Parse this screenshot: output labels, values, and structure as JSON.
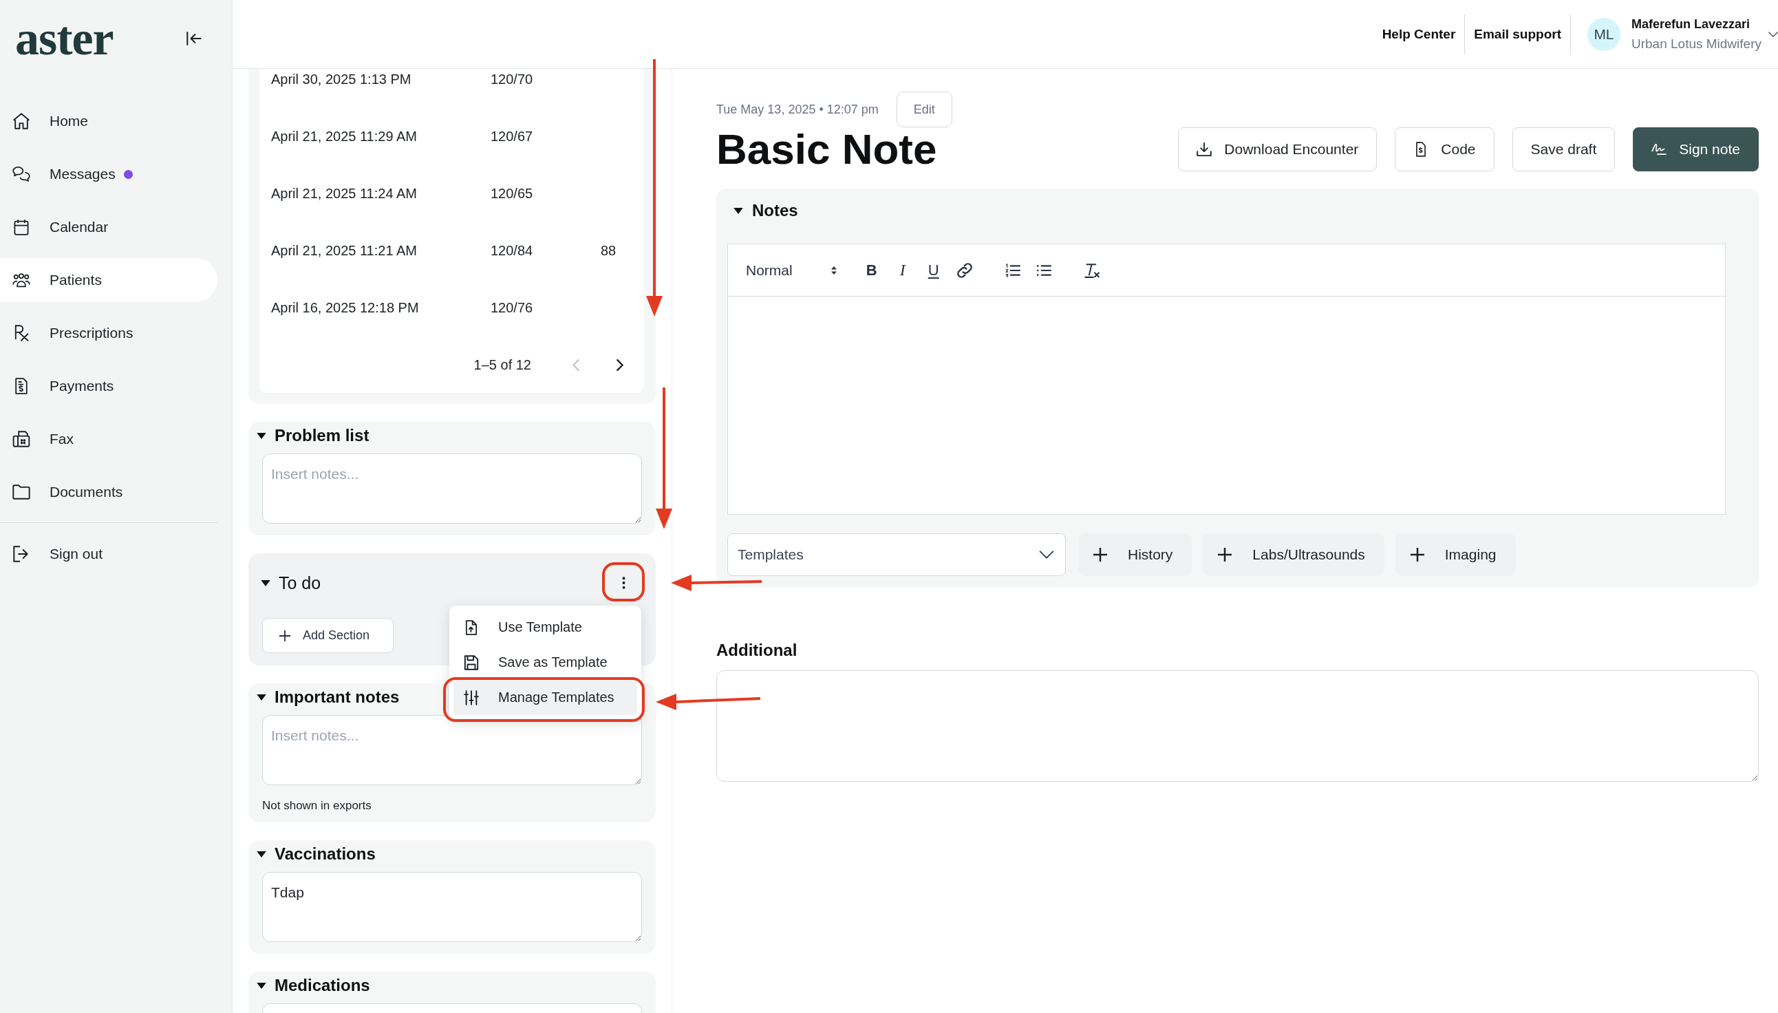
{
  "sidebar": {
    "logo": "aster",
    "items": [
      {
        "kind": "home",
        "label": "Home",
        "selected": false,
        "unread": false
      },
      {
        "kind": "messages",
        "label": "Messages",
        "selected": false,
        "unread": true
      },
      {
        "kind": "calendar",
        "label": "Calendar",
        "selected": false,
        "unread": false
      },
      {
        "kind": "patients",
        "label": "Patients",
        "selected": true,
        "unread": false
      },
      {
        "kind": "prescriptions",
        "label": "Prescriptions",
        "selected": false,
        "unread": false
      },
      {
        "kind": "payments",
        "label": "Payments",
        "selected": false,
        "unread": false
      },
      {
        "kind": "fax",
        "label": "Fax",
        "selected": false,
        "unread": false
      },
      {
        "kind": "documents",
        "label": "Documents",
        "selected": false,
        "unread": false
      }
    ],
    "sign_out": "Sign out"
  },
  "header": {
    "links": [
      "Help Center",
      "Email support"
    ],
    "user": {
      "initials": "ML",
      "name": "Maferefun Lavezzari",
      "organization": "Urban Lotus Midwifery"
    }
  },
  "vitals": {
    "rows": [
      {
        "cells": [
          "April 30, 2025 1:13 PM",
          "120/70"
        ]
      },
      {
        "cells": [
          "April 21, 2025 11:29 AM",
          "120/67"
        ]
      },
      {
        "cells": [
          "April 21, 2025 11:24 AM",
          "120/65"
        ]
      },
      {
        "cells": [
          "April 21, 2025 11:21 AM",
          "120/84",
          "88"
        ]
      },
      {
        "cells": [
          "April 16, 2025 12:18 PM",
          "120/76"
        ]
      }
    ],
    "pagination": {
      "range": "1–5 of 12",
      "previous_disabled": true,
      "next_disabled": false
    }
  },
  "sections": [
    {
      "kind": "text",
      "title": "Problem list",
      "expanded": true,
      "placeholder": "Insert notes..."
    },
    {
      "kind": "todo",
      "title": "To do",
      "expanded": true,
      "menu_button": {
        "annotated": true
      },
      "add_label": "Add Section",
      "menu": {
        "open": true,
        "items": [
          {
            "kind": "use",
            "label": "Use Template",
            "selected": false,
            "annotated": false
          },
          {
            "kind": "save",
            "label": "Save as Template",
            "selected": false,
            "annotated": false
          },
          {
            "kind": "manage",
            "label": "Manage Templates",
            "selected": true,
            "annotated": true
          }
        ]
      }
    },
    {
      "kind": "text",
      "title": "Important notes",
      "expanded": true,
      "placeholder": "Insert notes...",
      "note": "Not shown in exports"
    },
    {
      "kind": "text",
      "title": "Vaccinations",
      "expanded": true,
      "value": "Tdap"
    },
    {
      "kind": "text",
      "title": "Medications",
      "expanded": true
    }
  ],
  "encounter": {
    "datetime": "Tue May 13, 2025 • 12:07 pm",
    "edit": "Edit",
    "title": "Basic Note",
    "actions": [
      {
        "kind": "download",
        "label": "Download Encounter"
      },
      {
        "kind": "code",
        "label": "Code"
      },
      {
        "kind": "draft",
        "label": "Save draft"
      },
      {
        "kind": "sign",
        "label": "Sign note"
      }
    ]
  },
  "notes": {
    "title": "Notes",
    "expanded": true,
    "format": "Normal",
    "marks": [
      {
        "kind": "bold",
        "glyph": "B"
      },
      {
        "kind": "italic",
        "glyph": "I"
      },
      {
        "kind": "underline",
        "glyph": "U"
      }
    ],
    "templates_placeholder": "Templates",
    "add_buttons": [
      "History",
      "Labs/Ultrasounds",
      "Imaging"
    ]
  },
  "additional": {
    "label": "Additional"
  }
}
